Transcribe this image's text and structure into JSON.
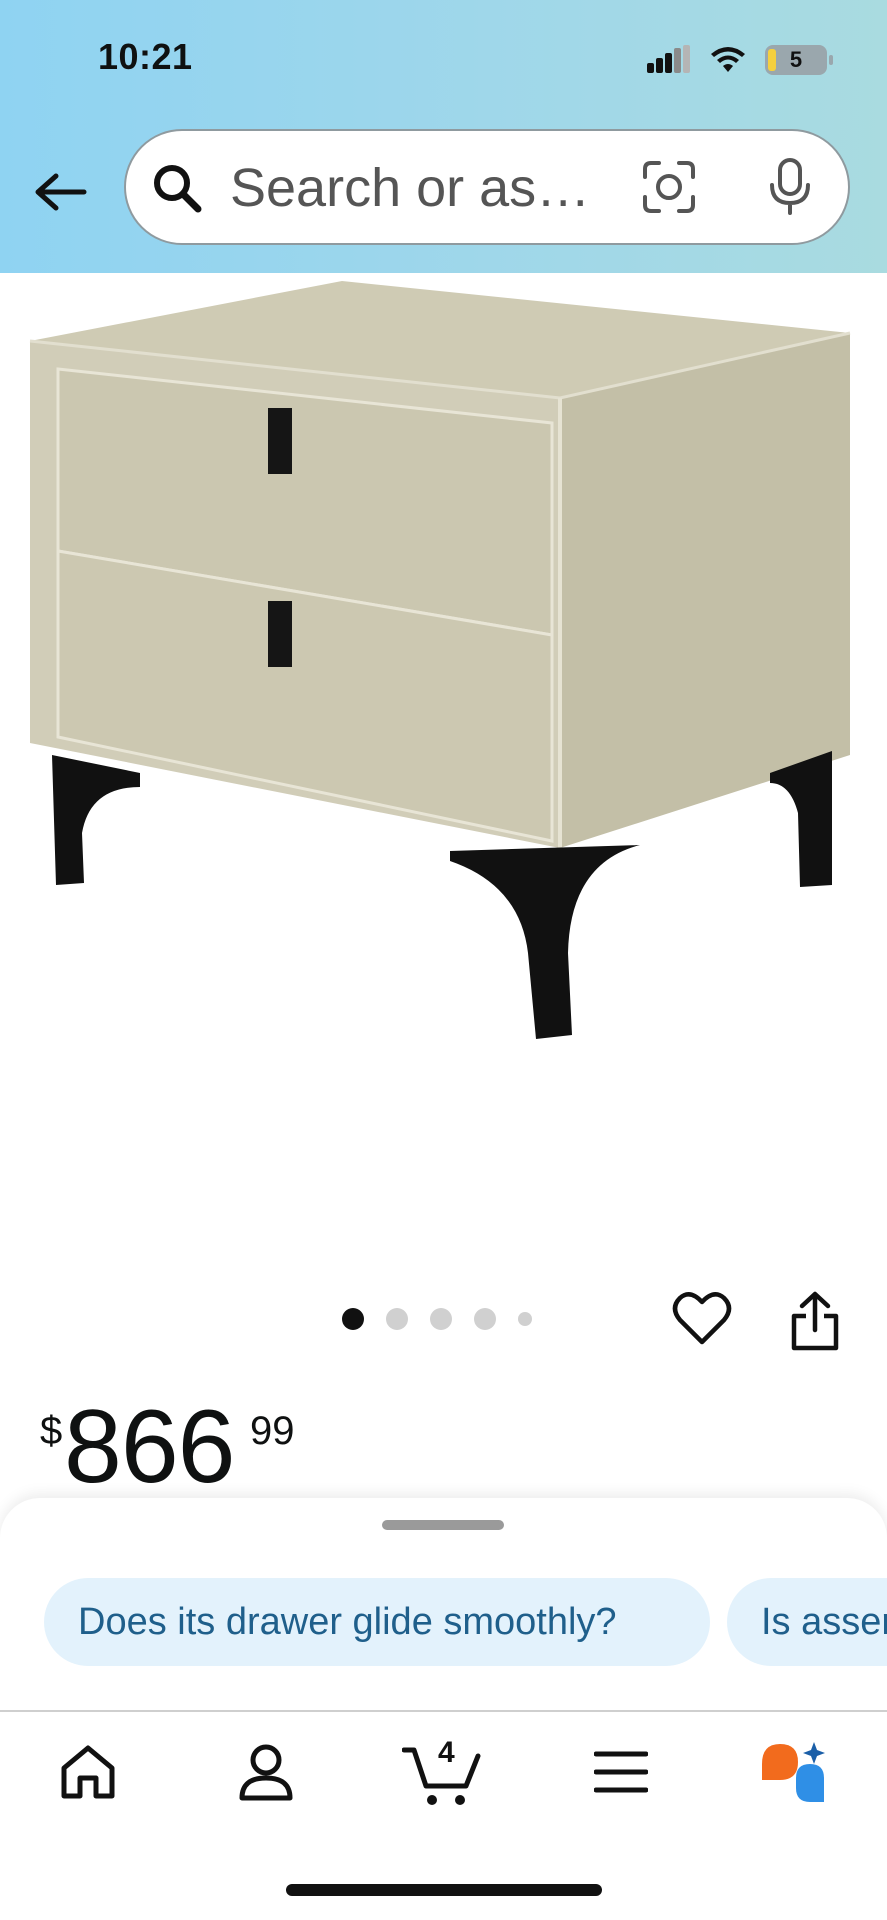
{
  "status_bar": {
    "time": "10:21",
    "battery_level": "5"
  },
  "search": {
    "placeholder": "Search or as…",
    "icons": [
      "search-icon",
      "camera-lens-icon",
      "microphone-icon"
    ]
  },
  "navigation": {
    "back_icon": "back-arrow-icon"
  },
  "product": {
    "image_description_icon": "nightstand-image",
    "carousel_dots": 5,
    "carousel_active_index": 0,
    "price_currency": "$",
    "price_whole": "866",
    "price_fraction": "99",
    "actions": [
      "heart-icon",
      "share-icon"
    ]
  },
  "suggestions": {
    "chips": [
      {
        "label": "Does its drawer glide smoothly?"
      },
      {
        "label": "Is asser"
      }
    ]
  },
  "bottom_nav": {
    "items": [
      "home-icon",
      "account-icon",
      "cart-icon",
      "menu-icon",
      "rufus-icon"
    ],
    "cart_count": "4"
  },
  "colors": {
    "header_gradient_start": "#8fd3f2",
    "header_gradient_end": "#a9dbe0",
    "chip_bg": "#e3f2fc",
    "chip_text": "#1f5f8b",
    "nightstand_body": "#cfcbb5",
    "nightstand_legs": "#111111",
    "rufus_orange": "#f26b1d",
    "rufus_blue": "#2f8fe6"
  }
}
